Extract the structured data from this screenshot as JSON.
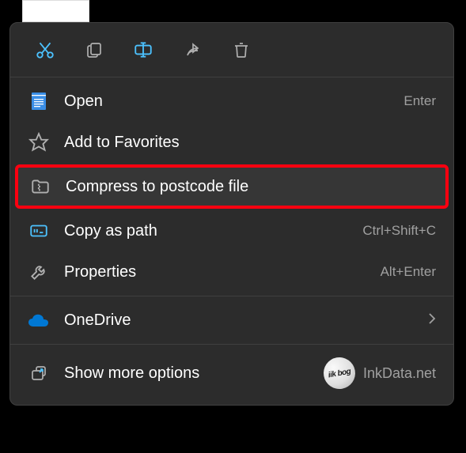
{
  "toolbar": {
    "cut": "cut",
    "copy": "copy",
    "rename": "rename",
    "share": "share",
    "delete": "delete"
  },
  "menu": {
    "open": {
      "label": "Open",
      "shortcut": "Enter"
    },
    "favorites": {
      "label": "Add to Favorites"
    },
    "compress": {
      "label": "Compress to postcode file"
    },
    "copypath": {
      "label": "Copy as path",
      "shortcut": "Ctrl+Shift+C"
    },
    "properties": {
      "label": "Properties",
      "shortcut": "Alt+Enter"
    },
    "onedrive": {
      "label": "OneDrive"
    },
    "more": {
      "label": "Show more options"
    }
  },
  "watermark": {
    "text": "InkData.net",
    "badge": "iik bog"
  }
}
